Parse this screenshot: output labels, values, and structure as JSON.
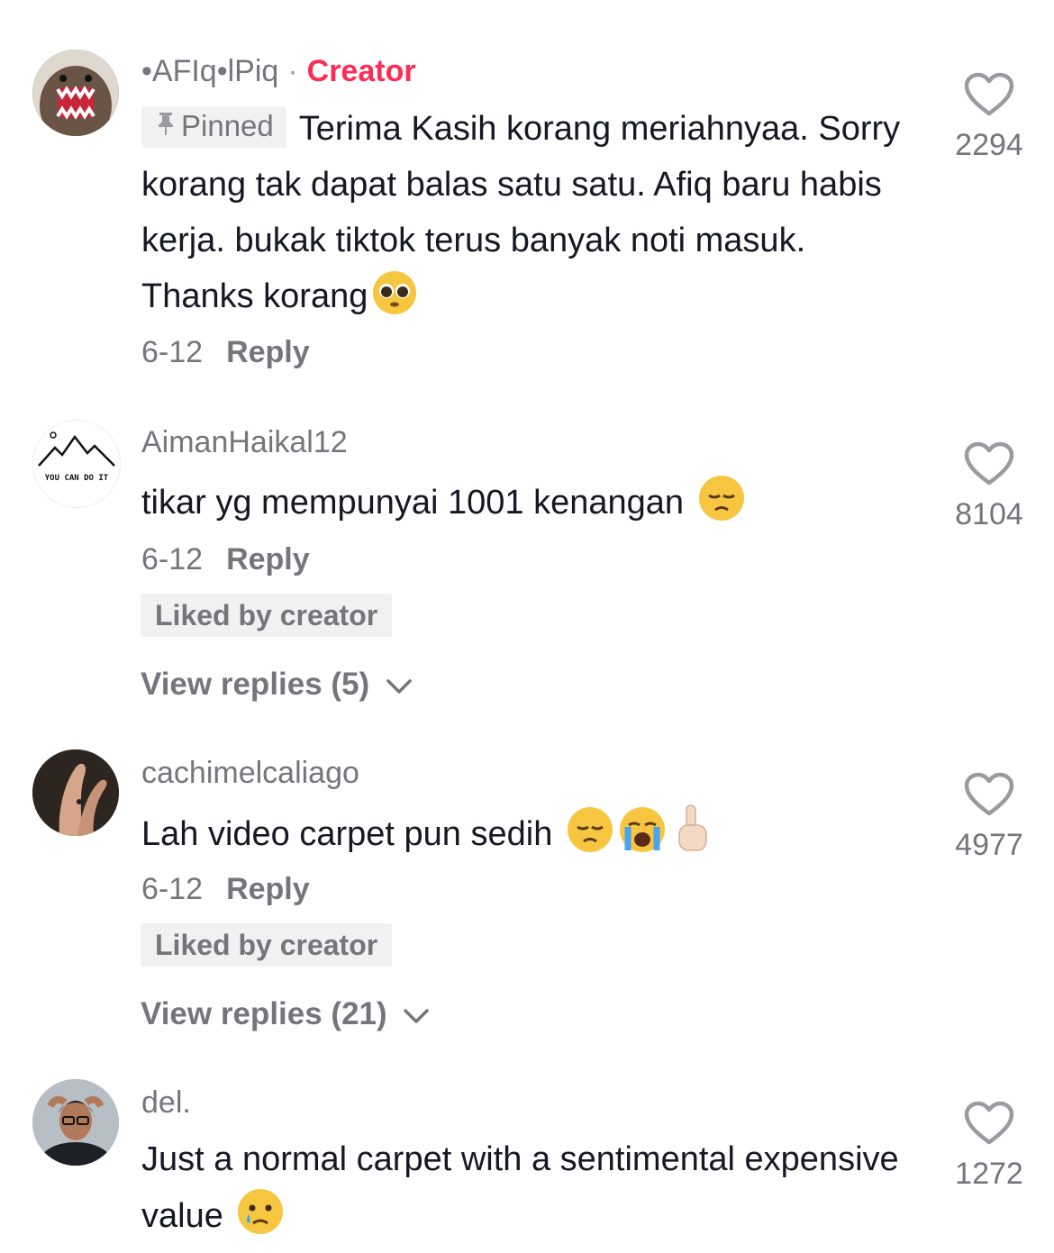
{
  "comments": [
    {
      "username": "•AFIq•lPiq",
      "separator": "·",
      "badge": "Creator",
      "pinned_label": "Pinned",
      "text": "Terima Kasih korang meriahnyaa. Sorry korang tak dapat balas satu satu. Afiq baru habis kerja. bukak tiktok terus banyak noti masuk. Thanks korang",
      "emojis": [
        "pleading-face"
      ],
      "date": "6-12",
      "reply_label": "Reply",
      "likes": "2294"
    },
    {
      "username": "AimanHaikal12",
      "avatar_text": "YOU CAN DO IT",
      "text": "tikar yg mempunyai 1001 kenangan",
      "emojis": [
        "pensive-face"
      ],
      "date": "6-12",
      "reply_label": "Reply",
      "liked_label": "Liked by creator",
      "view_replies": "View replies (5)",
      "likes": "8104"
    },
    {
      "username": "cachimelcaliago",
      "text": "Lah video carpet pun sedih",
      "emojis": [
        "pensive-face",
        "crying-face",
        "index-pointing-up"
      ],
      "date": "6-12",
      "reply_label": "Reply",
      "liked_label": "Liked by creator",
      "view_replies": "View replies (21)",
      "likes": "4977"
    },
    {
      "username": "del.",
      "text": "Just a normal carpet with a sentimental expensive value",
      "emojis": [
        "sad-tear-face"
      ],
      "likes": "1272"
    }
  ],
  "colors": {
    "creator_badge": "#fe2c55",
    "secondary_text": "#75767c",
    "chip_bg": "#f1f1f2"
  },
  "icons": [
    "heart-outline-icon",
    "chevron-down-icon",
    "pin-icon"
  ]
}
